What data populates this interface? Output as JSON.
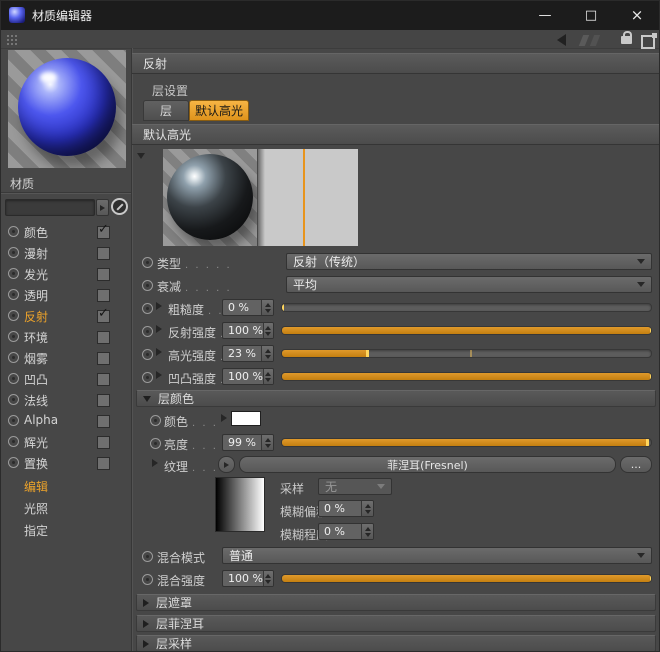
{
  "window": {
    "title": "材质编辑器",
    "min_glyph": "—",
    "max_glyph": "□",
    "close_glyph": "×"
  },
  "sidebar": {
    "material_label": "材质",
    "channels": [
      {
        "label": "颜色",
        "check": "✓"
      },
      {
        "label": "漫射",
        "check": ""
      },
      {
        "label": "发光",
        "check": ""
      },
      {
        "label": "透明",
        "check": ""
      },
      {
        "label": "反射",
        "check": "✓"
      },
      {
        "label": "环境",
        "check": ""
      },
      {
        "label": "烟雾",
        "check": ""
      },
      {
        "label": "凹凸",
        "check": ""
      },
      {
        "label": "法线",
        "check": ""
      },
      {
        "label": "Alpha",
        "check": ""
      },
      {
        "label": "辉光",
        "check": ""
      },
      {
        "label": "置换",
        "check": ""
      }
    ],
    "modes": [
      {
        "label": "编辑"
      },
      {
        "label": "光照"
      },
      {
        "label": "指定"
      }
    ]
  },
  "main": {
    "panel_title": "反射",
    "layer_settings": "层设置",
    "tabs": [
      {
        "label": "层"
      },
      {
        "label": "默认高光"
      }
    ],
    "section_title": "默认高光",
    "rows": {
      "type": {
        "label": "类型",
        "dots": ". . . . .",
        "value": "反射（传统）"
      },
      "falloff": {
        "label": "衰减",
        "dots": ". . . . .",
        "value": "平均"
      },
      "roughness": {
        "label": "粗糙度",
        "dots": ". .",
        "value": "0 %",
        "percent": 0
      },
      "reflection": {
        "label": "反射强度",
        "dots": ".",
        "value": "100 %",
        "percent": 100
      },
      "specular": {
        "label": "高光强度",
        "dots": ".",
        "value": "23 %",
        "percent": 23,
        "default_marker": 51
      },
      "bump": {
        "label": "凹凸强度",
        "dots": ".",
        "value": "100 %",
        "percent": 100
      }
    },
    "layer_color": {
      "title": "层颜色",
      "color": {
        "label": "颜色",
        "dots": ". . .",
        "swatch": "#ffffff"
      },
      "brightness": {
        "label": "亮度",
        "dots": ". . .",
        "value": "99 %",
        "percent": 99
      },
      "texture": {
        "label": "纹理",
        "dots": ". . .",
        "value": "菲涅耳(Fresnel)",
        "more": "..."
      },
      "sampling": {
        "label": "采样",
        "value": "无"
      },
      "blur_offset": {
        "label": "模糊偏移",
        "value": "0 %"
      },
      "blur_scale": {
        "label": "模糊程度",
        "value": "0 %"
      }
    },
    "mix_mode": {
      "label": "混合模式",
      "value": "普通"
    },
    "mix_strength": {
      "label": "混合强度",
      "value": "100 %",
      "percent": 100
    },
    "collapsed": [
      {
        "label": "层遮罩"
      },
      {
        "label": "层菲涅耳"
      },
      {
        "label": "层采样"
      }
    ]
  },
  "colors": {
    "accent": "#eda32a",
    "slider_fill": "#cf8a16",
    "marker": "#ffd65e",
    "titlebar": "#1c1c1c",
    "background": "#474747"
  }
}
